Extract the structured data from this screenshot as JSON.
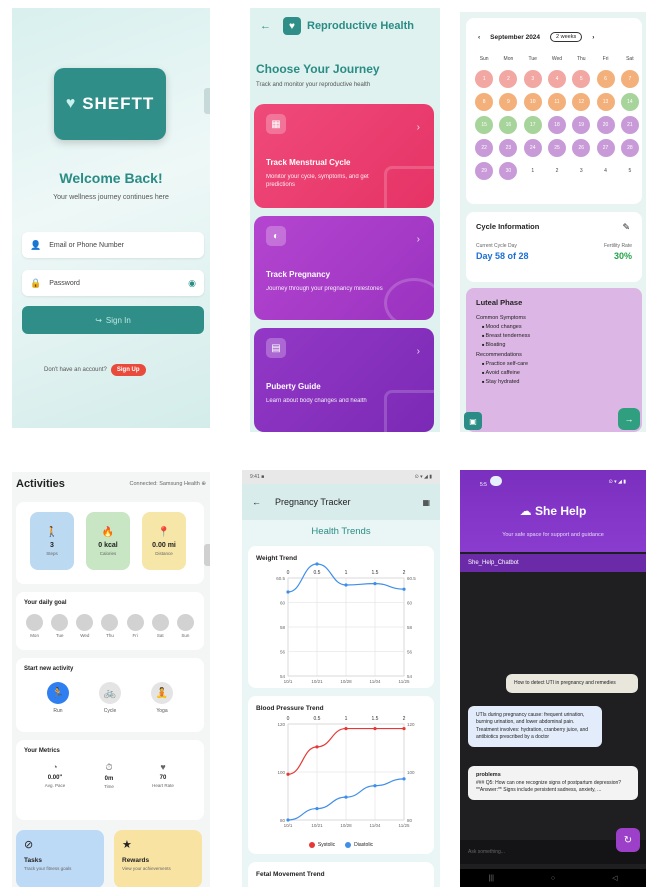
{
  "login": {
    "logo_text": "SHEFTT",
    "welcome": "Welcome Back!",
    "subtitle": "Your wellness journey continues here",
    "email_placeholder": "Email or Phone Number",
    "password_placeholder": "Password",
    "signin_label": "Sign In",
    "no_account": "Don't have an account?",
    "signup_label": "Sign Up",
    "accent": "#2f8f88"
  },
  "journey": {
    "header_title": "Reproductive Health",
    "choose_title": "Choose Your Journey",
    "choose_sub": "Track and monitor your reproductive health",
    "cards": [
      {
        "title": "Track Menstrual Cycle",
        "desc": "Monitor your cycle, symptoms, and get predictions",
        "color": "#ec3f73",
        "icon": "calendar-icon"
      },
      {
        "title": "Track Pregnancy",
        "desc": "Journey through your pregnancy milestones",
        "color": "#a53ac8",
        "icon": "pregnancy-icon"
      },
      {
        "title": "Puberty Guide",
        "desc": "Learn about body changes and health",
        "color": "#8a2fc0",
        "icon": "book-icon"
      }
    ]
  },
  "calendar": {
    "month": "September 2024",
    "view_pill": "2 weeks",
    "weekdays": [
      "Sun",
      "Mon",
      "Tue",
      "Wed",
      "Thu",
      "Fri",
      "Sat"
    ],
    "days": [
      {
        "d": "1",
        "c": "#f2a7a2"
      },
      {
        "d": "2",
        "c": "#f2a7a2"
      },
      {
        "d": "3",
        "c": "#f2a7a2"
      },
      {
        "d": "4",
        "c": "#f2a7a2"
      },
      {
        "d": "5",
        "c": "#f2a7a2"
      },
      {
        "d": "6",
        "c": "#f3b07b"
      },
      {
        "d": "7",
        "c": "#f3b07b"
      },
      {
        "d": "8",
        "c": "#f3b07b"
      },
      {
        "d": "9",
        "c": "#f3b07b"
      },
      {
        "d": "10",
        "c": "#f3b07b"
      },
      {
        "d": "11",
        "c": "#f3b07b"
      },
      {
        "d": "12",
        "c": "#f3b07b"
      },
      {
        "d": "13",
        "c": "#f3b07b"
      },
      {
        "d": "14",
        "c": "#a6d49a"
      },
      {
        "d": "15",
        "c": "#a6d49a"
      },
      {
        "d": "16",
        "c": "#a6d49a"
      },
      {
        "d": "17",
        "c": "#a6d49a"
      },
      {
        "d": "18",
        "c": "#c89bd8"
      },
      {
        "d": "19",
        "c": "#c89bd8"
      },
      {
        "d": "20",
        "c": "#c89bd8"
      },
      {
        "d": "21",
        "c": "#c89bd8"
      },
      {
        "d": "22",
        "c": "#c89bd8"
      },
      {
        "d": "23",
        "c": "#c89bd8"
      },
      {
        "d": "24",
        "c": "#c89bd8"
      },
      {
        "d": "25",
        "c": "#c89bd8"
      },
      {
        "d": "26",
        "c": "#c89bd8"
      },
      {
        "d": "27",
        "c": "#c89bd8"
      },
      {
        "d": "28",
        "c": "#c89bd8"
      },
      {
        "d": "29",
        "c": "#c89bd8"
      },
      {
        "d": "30",
        "c": "#c89bd8"
      },
      {
        "d": "1",
        "c": ""
      },
      {
        "d": "2",
        "c": ""
      },
      {
        "d": "3",
        "c": ""
      },
      {
        "d": "4",
        "c": ""
      },
      {
        "d": "5",
        "c": ""
      }
    ],
    "cycle_title": "Cycle Information",
    "current_label": "Current Cycle Day",
    "current_value": "Day 58 of 28",
    "fertility_label": "Fertility Rate",
    "fertility_value": "30%",
    "phase_title": "Luteal Phase",
    "symptoms_label": "Common Symptoms",
    "symptoms": [
      "Mood changes",
      "Breast tenderness",
      "Bloating"
    ],
    "recs_label": "Recommendations",
    "recs": [
      "Practice self-care",
      "Avoid caffeine",
      "Stay hydrated"
    ]
  },
  "activities": {
    "title": "Activities",
    "connected": "Connected: Samsung Health ⊕",
    "stats": [
      {
        "value": "3",
        "label": "Steps",
        "icon": "walk-icon",
        "bg": "#bcd9f2"
      },
      {
        "value": "0 kcal",
        "label": "Calories",
        "icon": "flame-icon",
        "bg": "#c8e6c4"
      },
      {
        "value": "0.00 mi",
        "label": "Distance",
        "icon": "pin-icon",
        "bg": "#f6e6a8"
      }
    ],
    "daily_goal": "Your daily goal",
    "week": [
      "Mon",
      "Tue",
      "Wed",
      "Thu",
      "Fri",
      "Sat",
      "Sun"
    ],
    "start_new": "Start new activity",
    "options": [
      {
        "name": "Run",
        "icon": "run-icon"
      },
      {
        "name": "Cycle",
        "icon": "bike-icon"
      },
      {
        "name": "Yoga",
        "icon": "yoga-icon"
      }
    ],
    "metrics_title": "Your Metrics",
    "metrics": [
      {
        "value": "0.00\"",
        "label": "Avg. Pace",
        "icon": "speed-icon"
      },
      {
        "value": "0m",
        "label": "Time",
        "icon": "timer-icon"
      },
      {
        "value": "70",
        "label": "Heart Rate",
        "icon": "heart-icon"
      }
    ],
    "tasks_title": "Tasks",
    "tasks_desc": "Track your fitness goals",
    "rewards_title": "Rewards",
    "rewards_desc": "View your achievements"
  },
  "pregnancy": {
    "status_left": "9:41 ■",
    "status_right": "⊙ ▾ ◢ ▮",
    "title": "Pregnancy Tracker",
    "health_trends": "Health Trends",
    "weight_title": "Weight Trend",
    "bp_title": "Blood Pressure Trend",
    "fetal_title": "Fetal Movement Trend",
    "legend_systolic": "Systolic",
    "legend_diastolic": "Diastolic"
  },
  "chart_data": [
    {
      "type": "line",
      "title": "Weight Trend",
      "x": [
        "10/1",
        "10/21",
        "10/28",
        "11/04",
        "11/25"
      ],
      "top_ticks": [
        "0",
        "0.5",
        "1",
        "1.5",
        "2"
      ],
      "series": [
        {
          "values": [
            60,
            62,
            60.5,
            60.6,
            60.2
          ]
        }
      ],
      "y_ticks": [
        "60.5",
        "60",
        "58",
        "56",
        "54"
      ],
      "ylim": [
        54,
        61
      ]
    },
    {
      "type": "line",
      "title": "Blood Pressure Trend",
      "x": [
        "10/1",
        "10/21",
        "10/28",
        "11/04",
        "11/25"
      ],
      "top_ticks": [
        "0",
        "0.5",
        "1",
        "1.5",
        "2"
      ],
      "series": [
        {
          "name": "Systolic",
          "color": "#e53935",
          "values": [
            100,
            112,
            120,
            120,
            120
          ]
        },
        {
          "name": "Diastolic",
          "color": "#3f8ee8",
          "values": [
            80,
            85,
            90,
            95,
            98
          ]
        }
      ],
      "y_ticks": [
        "120",
        "100",
        "80"
      ],
      "ylim": [
        80,
        122
      ]
    }
  ],
  "shehelp": {
    "status_left": "5:5",
    "status_right": "⊙ ▾ ◢ ▮",
    "title": "She Help",
    "subtitle": "Your safe space for support and guidance",
    "chat_label": "She_Help_Chatbot",
    "user_msg": "How to detect UTI in pregnancy and remedies",
    "bot_msg": "UTIs during pregnancy cause: frequent urination, burning urination, and lower abdominal pain. Treatment involves: hydration, cranberry juice, and antibiotics prescribed by a doctor",
    "problem_title": "problems",
    "problem_msg": "### Q5: How can one recognize signs of postpartum depression? **Answer:** Signs include persistent sadness, anxiety, ...",
    "input_placeholder": "Ask something...",
    "nav": [
      "|||",
      "○",
      "◁"
    ]
  }
}
